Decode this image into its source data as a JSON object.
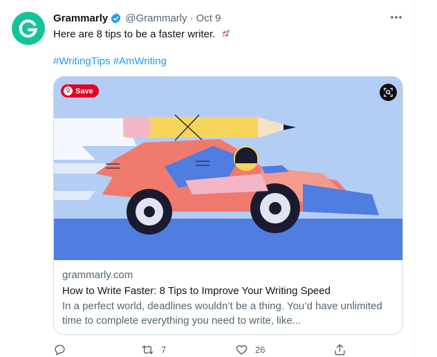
{
  "tweet": {
    "author_name": "Grammarly",
    "handle": "@Grammarly",
    "separator": "·",
    "date": "Oct 9",
    "text": "Here are 8 tips to be a faster writer.",
    "hashtags": [
      "#WritingTips",
      "#AmWriting"
    ],
    "colors": {
      "accent": "#1d9bf0",
      "brand": "#15c39a",
      "muted": "#536471"
    }
  },
  "card": {
    "save_label": "Save",
    "domain": "grammarly.com",
    "title": "How to Write Faster: 8 Tips to Improve Your Writing Speed",
    "description": "In a perfect world, deadlines wouldn’t be a thing. You’d have unlimited time to complete everything you need to write, like..."
  },
  "actions": {
    "replies": "",
    "retweets": "7",
    "likes": "26",
    "icons": [
      "reply-icon",
      "retweet-icon",
      "like-icon",
      "share-icon"
    ]
  }
}
